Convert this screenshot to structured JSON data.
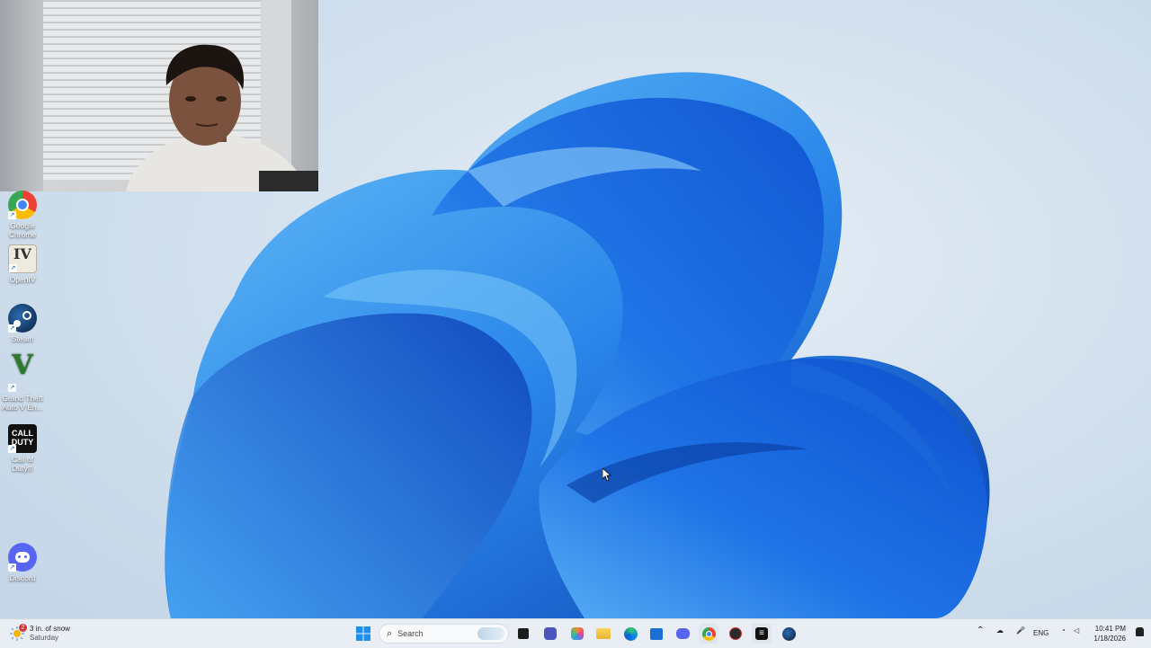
{
  "desktop": {
    "icons": [
      {
        "label": "Google Chrome",
        "icon": "chrome-icon"
      },
      {
        "label": "OpenIV",
        "icon": "openiv-icon"
      },
      {
        "label": "Steam",
        "icon": "steam-icon"
      },
      {
        "label": "Grand Theft Auto V En...",
        "icon": "gta-v-icon"
      },
      {
        "label": "Call of Duty®",
        "icon": "call-of-duty-icon"
      },
      {
        "label": "Discord",
        "icon": "discord-icon"
      }
    ]
  },
  "taskbar": {
    "weather": {
      "text": "3 in. of snow",
      "day": "Saturday",
      "badge": "2"
    },
    "search_placeholder": "Search",
    "apps": [
      "start-icon",
      "search-icon",
      "widgets-icon",
      "task-view-icon",
      "chat-icon",
      "copilot-icon",
      "file-explorer-icon",
      "edge-icon",
      "store-icon",
      "discord-icon",
      "chrome-icon",
      "game-icon",
      "capcut-icon",
      "steam-icon"
    ],
    "tray": {
      "language": "ENG",
      "time": "10:41 PM",
      "date": "1/18/2026"
    }
  },
  "colors": {
    "accent": "#1f6fe0",
    "wallpaper_dark": "#0d47c7",
    "wallpaper_light": "#5ab4f5"
  }
}
